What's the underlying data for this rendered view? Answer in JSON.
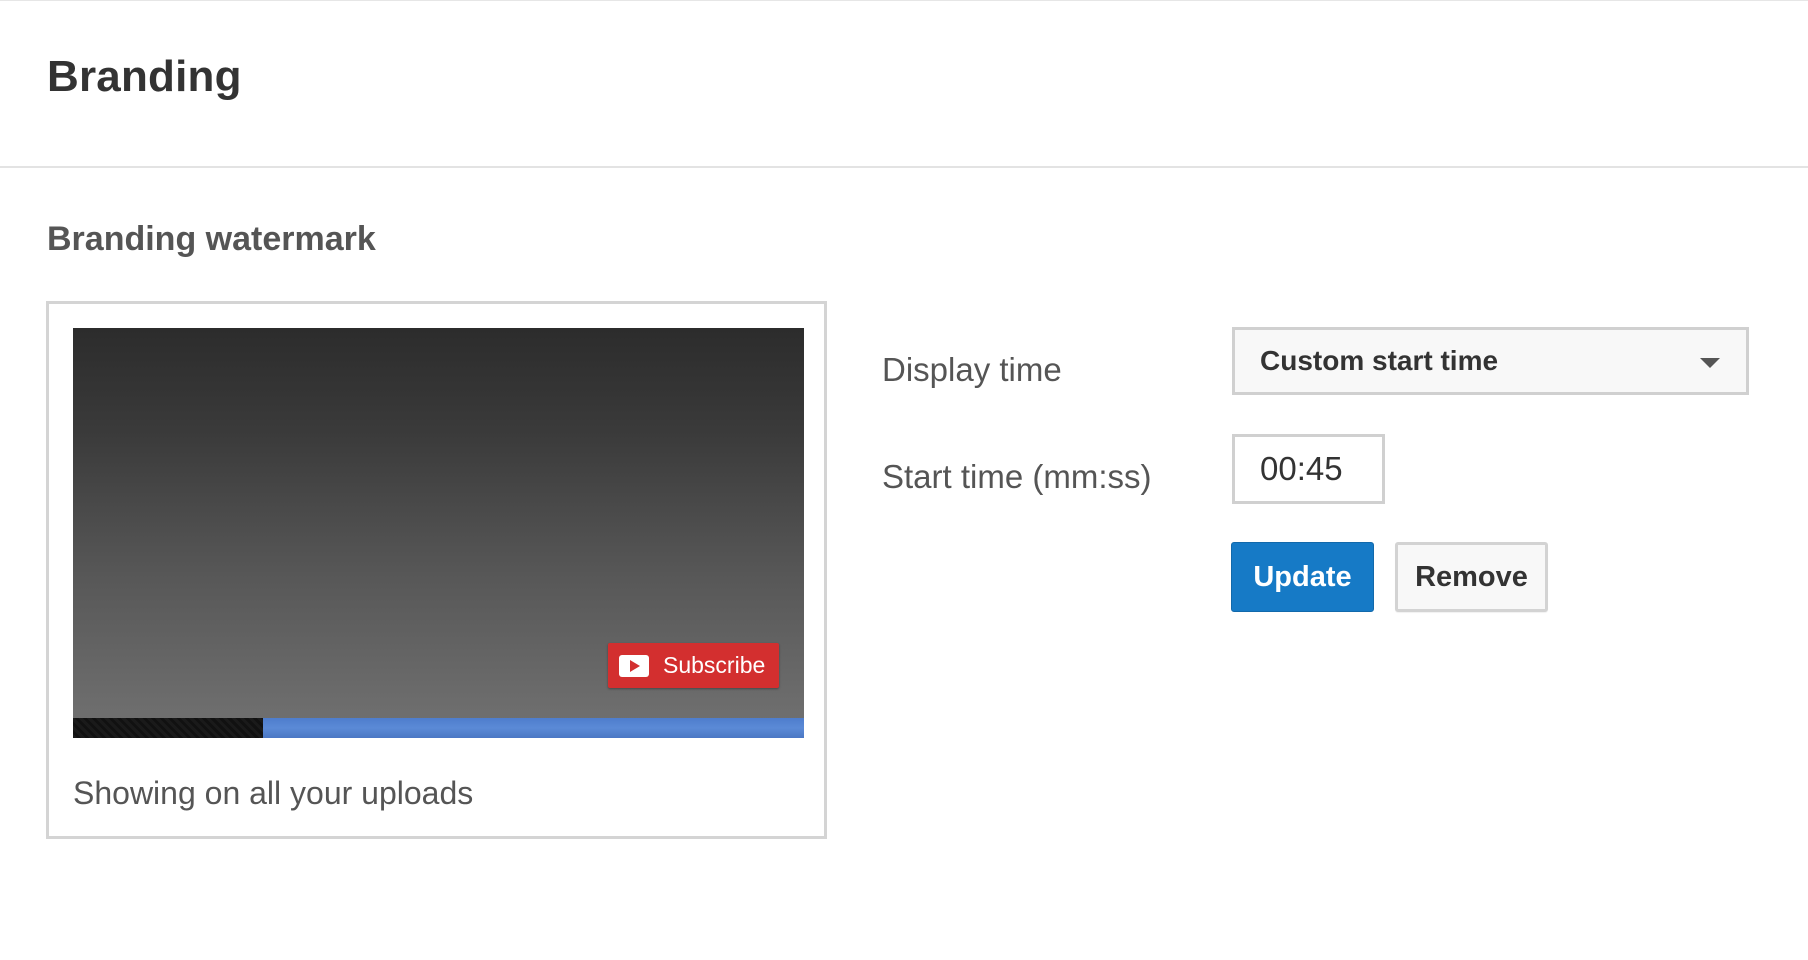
{
  "header": {
    "title": "Branding"
  },
  "watermark": {
    "section_title": "Branding watermark",
    "preview": {
      "subscribe_label": "Subscribe",
      "subscribe_icon": "youtube-play-icon",
      "progress_fraction": 0.74,
      "progress_color": "#5b8ad6",
      "badge_color": "#d32f2f"
    },
    "caption": "Showing on all your uploads"
  },
  "settings": {
    "display_time_label": "Display time",
    "display_time_value": "Custom start time",
    "start_time_label": "Start time (mm:ss)",
    "start_time_value": "00:45",
    "update_label": "Update",
    "remove_label": "Remove",
    "accent_color": "#167ac6"
  }
}
